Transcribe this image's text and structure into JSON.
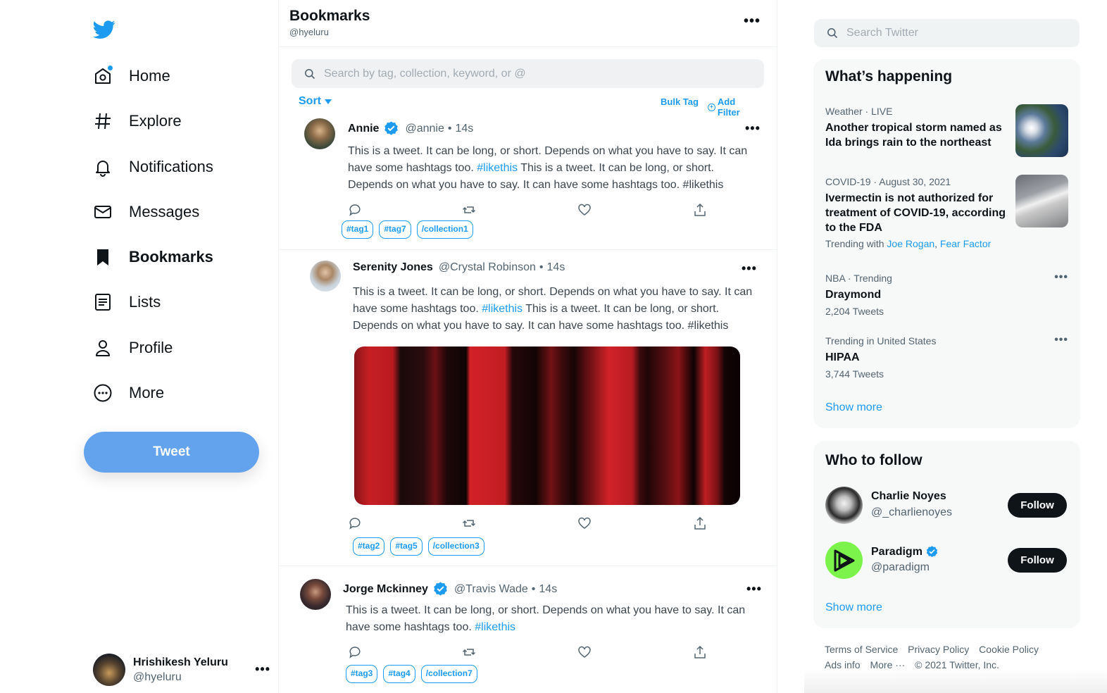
{
  "nav": {
    "items": [
      {
        "label": "Home",
        "icon": "home-icon"
      },
      {
        "label": "Explore",
        "icon": "hashtag-icon"
      },
      {
        "label": "Notifications",
        "icon": "bell-icon"
      },
      {
        "label": "Messages",
        "icon": "envelope-icon"
      },
      {
        "label": "Bookmarks",
        "icon": "bookmark-icon"
      },
      {
        "label": "Lists",
        "icon": "list-icon"
      },
      {
        "label": "Profile",
        "icon": "person-icon"
      },
      {
        "label": "More",
        "icon": "more-circle-icon"
      }
    ],
    "tweet_button": "Tweet",
    "account": {
      "name": "Hrishikesh Yeluru",
      "handle": "@hyeluru",
      "more": "•••"
    }
  },
  "header": {
    "title": "Bookmarks",
    "subtitle": "@hyeluru",
    "more": "•••"
  },
  "search": {
    "placeholder": "Search by tag, collection, keyword, or @"
  },
  "toolbar": {
    "sort": "Sort",
    "bulk_tag": "Bulk Tag",
    "add_filter": "Add Filter"
  },
  "tweets": [
    {
      "name": "Annie",
      "handle": "@annie",
      "time": "14s",
      "body_1": "This is a tweet. It can be long, or short. Depends on what you have to say. It can have some hashtags too.",
      "hashtag": "#likethis",
      "body_2": "This is a tweet. It can be long, or short. Depends on what you have to say. It can have some hashtags too. #likethis",
      "tags": [
        "#tag1",
        "#tag7",
        "/collection1"
      ]
    },
    {
      "name": "Serenity Jones",
      "handle": "@Crystal Robinson",
      "time": "14s",
      "body_1": "This is a tweet. It can be long, or short. Depends on what you have to say. It can have some hashtags too.",
      "hashtag": "#likethis",
      "body_2": "This is a tweet. It can be long, or short. Depends on what you have to say. It can have some hashtags too. #likethis",
      "tags": [
        "#tag2",
        "#tag5",
        "/collection3"
      ]
    },
    {
      "name": "Jorge Mckinney",
      "handle": "@Travis Wade",
      "time": "14s",
      "body_1": "This is a tweet. It can be long, or short. Depends on what you have to say. It can have some hashtags too.",
      "hashtag": "#likethis",
      "body_2": "",
      "tags": [
        "#tag3",
        "#tag4",
        "/collection7"
      ]
    }
  ],
  "right": {
    "search_placeholder": "Search Twitter",
    "happening": {
      "title": "What’s happening",
      "trends": [
        {
          "context": "Weather · LIVE",
          "title": "Another tropical storm named as Ida brings rain to the northeast"
        },
        {
          "context": "COVID-19 · August 30, 2021",
          "title": "Ivermectin is not authorized for treatment of COVID-19, according to the FDA",
          "trending_with": "Trending with",
          "links": [
            "Joe Rogan",
            "Fear Factor"
          ]
        },
        {
          "context": "NBA · Trending",
          "title": "Draymond",
          "count": "2,204 Tweets"
        },
        {
          "context": "Trending in United States",
          "title": "HIPAA",
          "count": "3,744 Tweets"
        }
      ],
      "show_more": "Show more"
    },
    "who_to_follow": {
      "title": "Who to follow",
      "people": [
        {
          "name": "Charlie Noyes",
          "handle": "@_charlienoyes",
          "button": "Follow"
        },
        {
          "name": "Paradigm",
          "handle": "@paradigm",
          "button": "Follow"
        }
      ],
      "show_more": "Show more"
    },
    "footer": [
      "Terms of Service",
      "Privacy Policy",
      "Cookie Policy",
      "Ads info",
      "More ···",
      "© 2021 Twitter, Inc."
    ]
  },
  "colors": {
    "accent": "#1d9bf0",
    "tweet_button": "#63a3ee",
    "text": "#0f1419",
    "muted": "#536471"
  }
}
